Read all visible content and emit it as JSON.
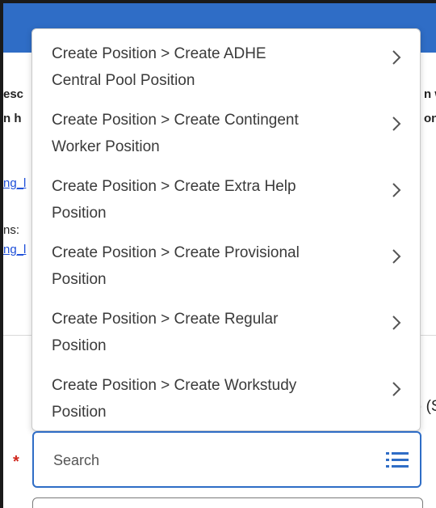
{
  "background": {
    "left_lines": [
      {
        "text": "esc",
        "bold": true
      },
      {
        "text": "n h",
        "bold": true
      },
      {
        "text": "ng_l",
        "link": true
      },
      {
        "text": "ns:",
        "bold": false
      },
      {
        "text": "ng_l",
        "link": true
      }
    ],
    "right_lines": [
      {
        "text": "n w",
        "bold": true
      },
      {
        "text": "on",
        "bold": true
      },
      {
        "text": ") (S",
        "bold": false
      }
    ],
    "required_marker": "*"
  },
  "dropdown": {
    "items": [
      {
        "line1": "Create Position > Create ADHE",
        "line2": "Central Pool Position"
      },
      {
        "line1": "Create Position > Create Contingent",
        "line2": "Worker Position"
      },
      {
        "line1": "Create Position > Create Extra Help",
        "line2": "Position"
      },
      {
        "line1": "Create Position > Create Provisional",
        "line2": "Position"
      },
      {
        "line1": "Create Position > Create Regular",
        "line2": "Position"
      },
      {
        "line1": "Create Position > Create Workstudy",
        "line2": "Position"
      }
    ],
    "icon": "chevron-right-icon"
  },
  "search": {
    "placeholder": "Search",
    "icon": "list-icon"
  },
  "colors": {
    "header": "#2f6dc6",
    "accent": "#2f6dc6",
    "required": "#d0271d"
  }
}
